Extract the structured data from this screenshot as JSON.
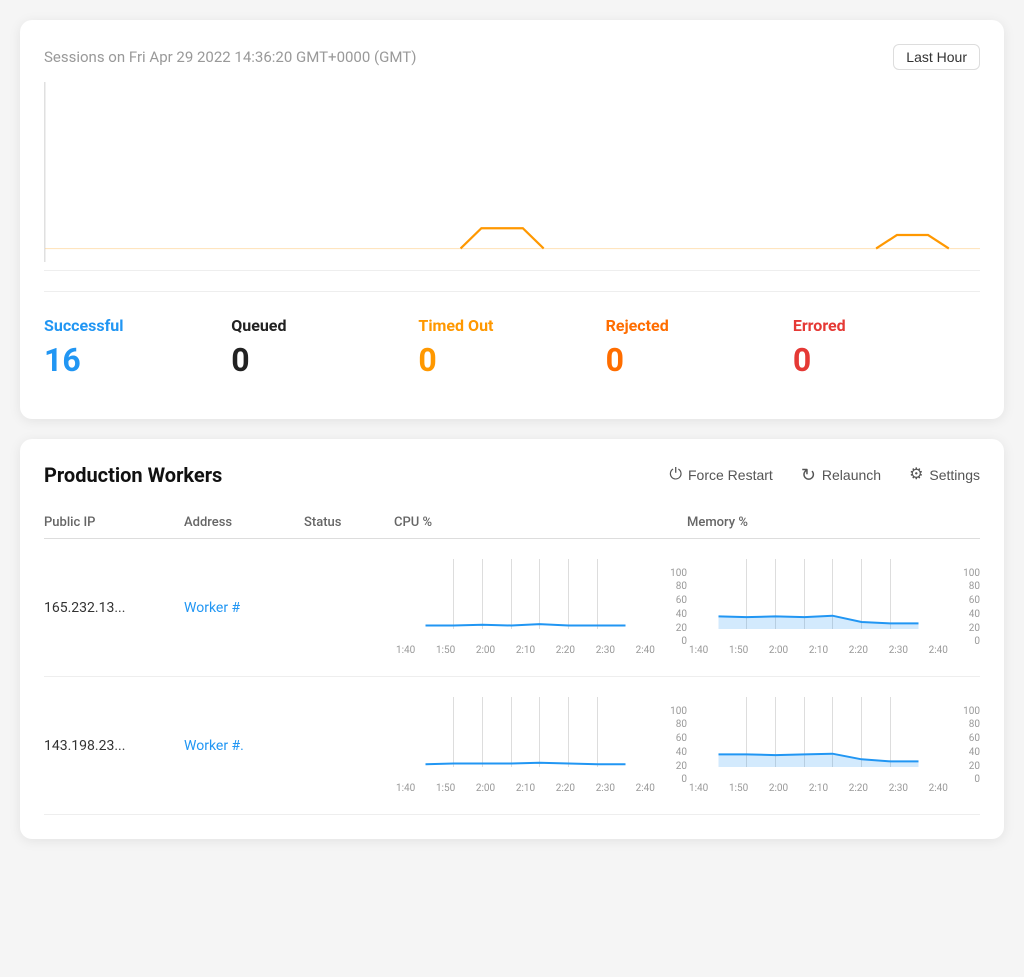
{
  "sessions": {
    "title": "Sessions on Fri Apr 29 2022 14:36:20 GMT+0000 (GMT)",
    "time_range_label": "Last Hour"
  },
  "stats": [
    {
      "key": "successful",
      "label": "Successful",
      "value": "16",
      "color_class": "successful"
    },
    {
      "key": "queued",
      "label": "Queued",
      "value": "0",
      "color_class": "queued"
    },
    {
      "key": "timedout",
      "label": "Timed Out",
      "value": "0",
      "color_class": "timedout"
    },
    {
      "key": "rejected",
      "label": "Rejected",
      "value": "0",
      "color_class": "rejected"
    },
    {
      "key": "errored",
      "label": "Errored",
      "value": "0",
      "color_class": "errored"
    }
  ],
  "workers_section": {
    "title": "Production Workers",
    "actions": [
      {
        "key": "force-restart",
        "label": "Force Restart",
        "icon": "⏻"
      },
      {
        "key": "relaunch",
        "label": "Relaunch",
        "icon": "↻"
      },
      {
        "key": "settings",
        "label": "Settings",
        "icon": "⚙"
      }
    ],
    "table_headers": [
      "Public IP",
      "Address",
      "Status",
      "CPU %",
      "Memory %"
    ],
    "workers": [
      {
        "ip": "165.232.13...",
        "address": "Worker #",
        "status": "",
        "cpu_times": [
          "1:40",
          "1:50",
          "2:00",
          "2:10",
          "2:20",
          "2:30",
          "2:40"
        ],
        "cpu_values": [
          5,
          5,
          6,
          5,
          7,
          5,
          5
        ],
        "mem_times": [
          "1:40",
          "1:50",
          "2:00",
          "2:10",
          "2:20",
          "2:30",
          "2:40"
        ],
        "mem_values": [
          18,
          17,
          18,
          17,
          19,
          10,
          8
        ]
      },
      {
        "ip": "143.198.23...",
        "address": "Worker #.",
        "status": "",
        "cpu_times": [
          "1:40",
          "1:50",
          "2:00",
          "2:10",
          "2:20",
          "2:30",
          "2:40"
        ],
        "cpu_values": [
          4,
          5,
          5,
          5,
          6,
          5,
          4
        ],
        "mem_values": [
          18,
          18,
          17,
          18,
          19,
          11,
          8
        ]
      }
    ]
  }
}
